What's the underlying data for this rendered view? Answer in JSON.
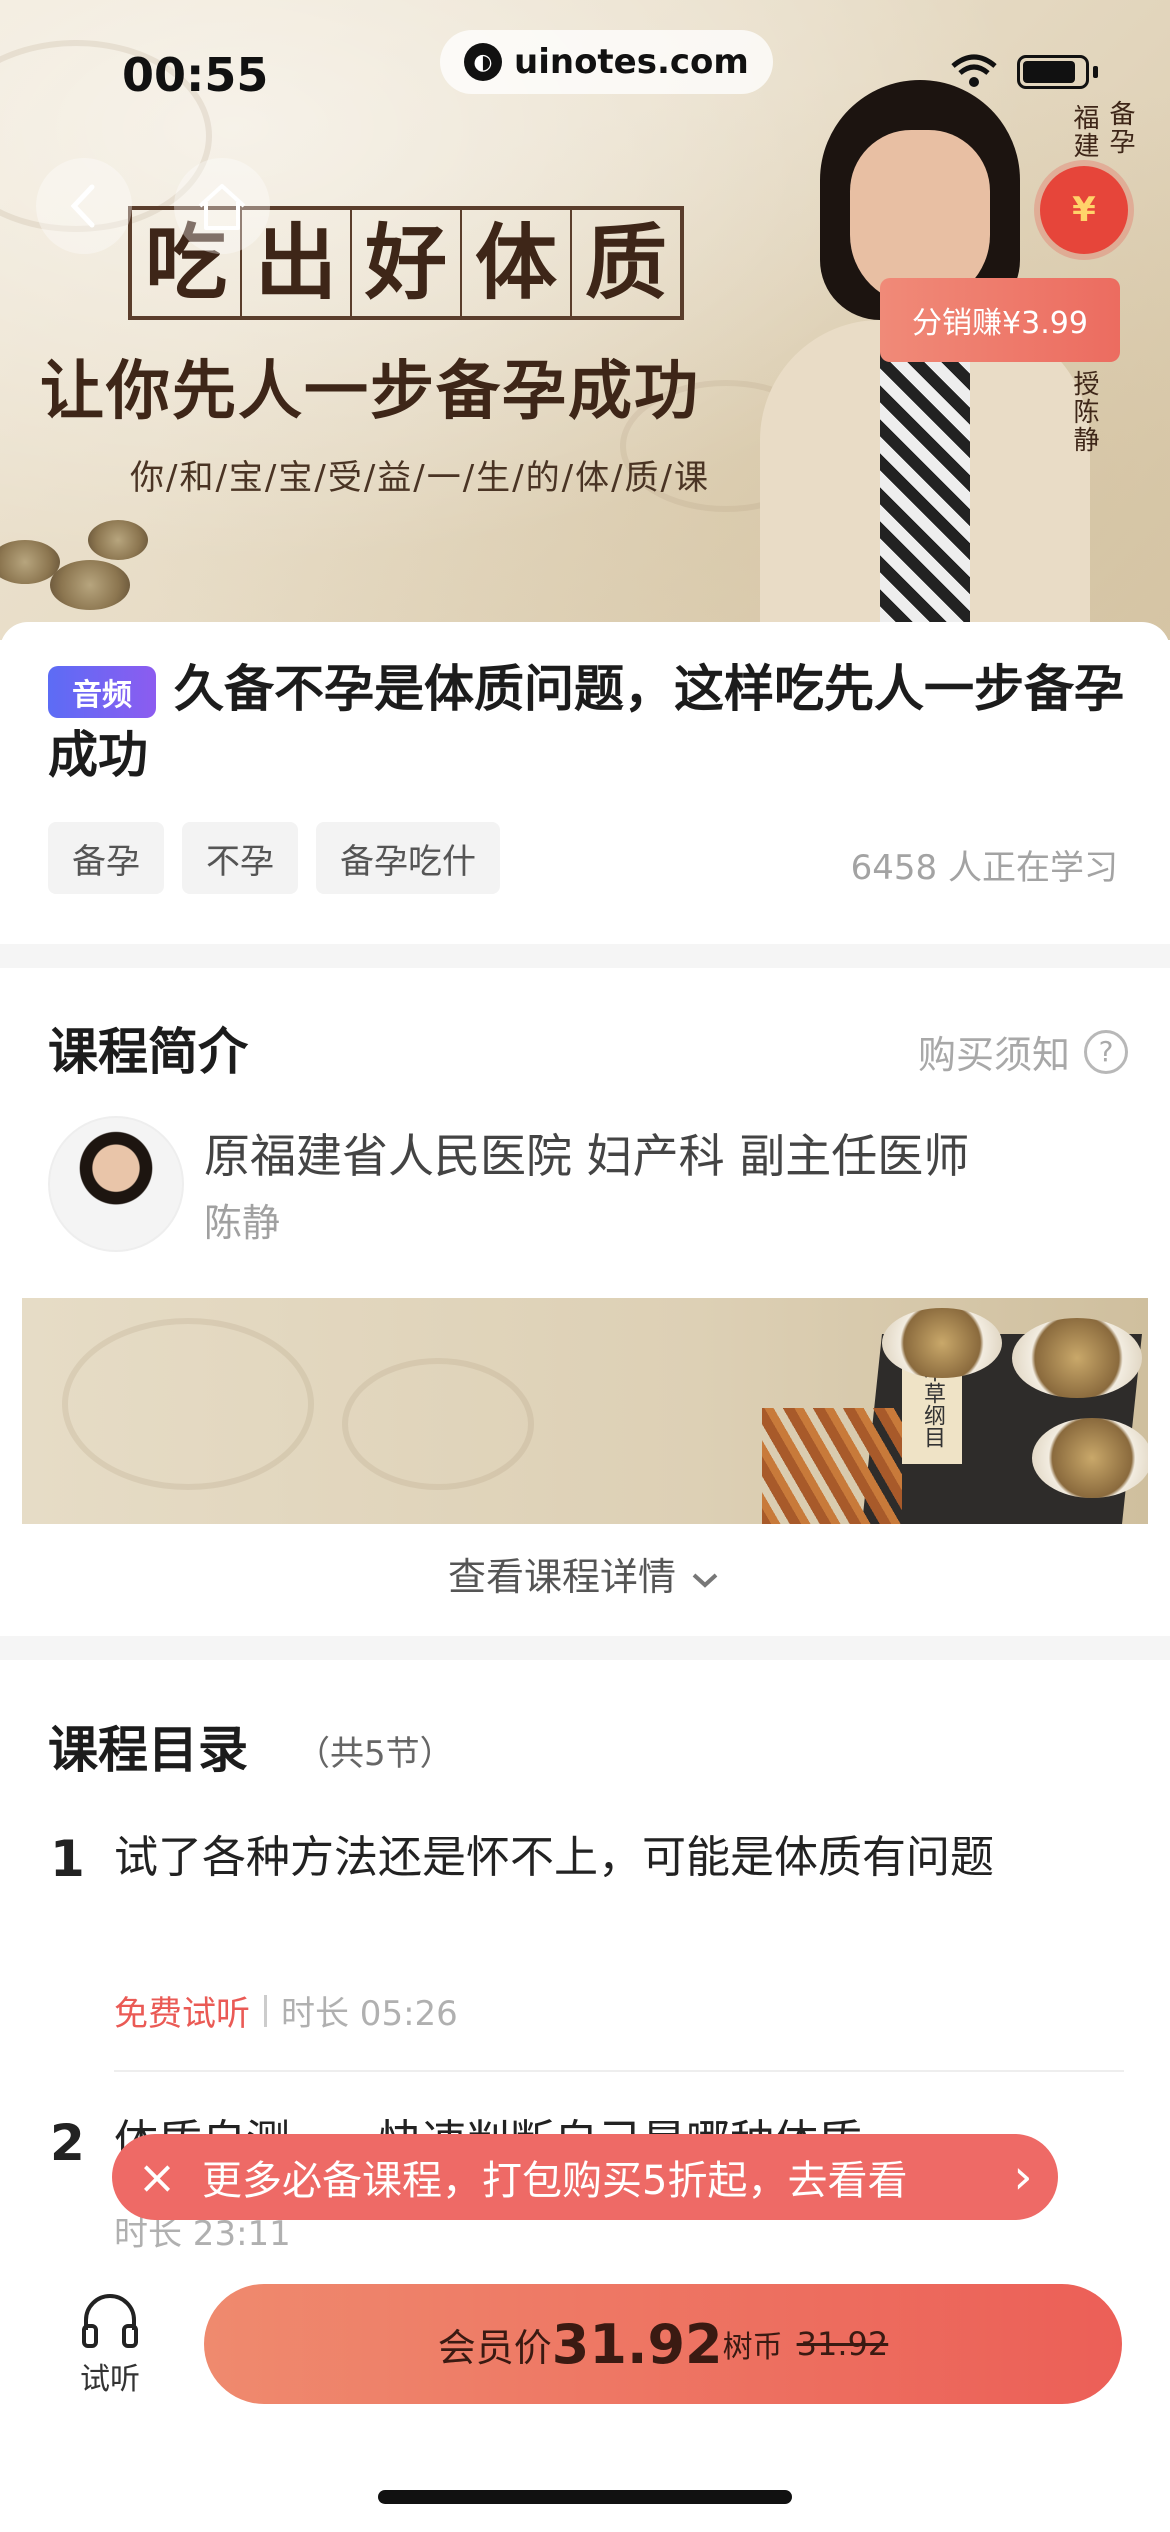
{
  "status_bar": {
    "time": "00:55",
    "url": "uinotes.com"
  },
  "hero": {
    "headline_chars": [
      "吃",
      "出",
      "好",
      "体",
      "质"
    ],
    "subtitle": "让你先人一步备孕成功",
    "tagline": "你/和/宝/宝/受/益/一/生/的/体/质/课",
    "side_text_left": "福建",
    "side_text_right": "备孕",
    "side_text_bottom": "授陈静",
    "coin_symbol": "¥",
    "distribution_badge": "分销赚¥3.99"
  },
  "course": {
    "type_tag": "音频",
    "title": "久备不孕是体质问题，这样吃先人一步备孕成功",
    "tags": [
      "备孕",
      "不孕",
      "备孕吃什"
    ],
    "learners": "6458 人正在学习"
  },
  "intro": {
    "heading": "课程简介",
    "purchase_notice": "购买须知",
    "purchase_notice_icon": "?",
    "doctor_title": "原福建省人民医院 妇产科 副主任医师",
    "doctor_name": "陈静",
    "banner_book_title": "本草纲目",
    "view_details": "查看课程详情"
  },
  "catalog": {
    "heading": "课程目录",
    "count": "（共5节）",
    "lessons": [
      {
        "number": "1",
        "title": "试了各种方法还是怀不上，可能是体质有问题",
        "free_label": "免费试听",
        "duration": "时长 05:26"
      },
      {
        "number": "2",
        "title": "体质自测——快速判断自己是哪种体质",
        "duration": "时长 23:11"
      }
    ]
  },
  "promo": {
    "close": "×",
    "text": "更多必备课程，打包购买5折起，去看看",
    "arrow": "›"
  },
  "bottom_bar": {
    "listen_label": "试听",
    "price_prefix": "会员价",
    "price": "31.92",
    "currency": "树币",
    "original_price": "31.92"
  },
  "colors": {
    "accent_red": "#ec5f57",
    "audio_tag": "#6a64f3",
    "free_red": "#ea5a55"
  },
  "icons": [
    "back-icon",
    "home-icon",
    "wifi-icon",
    "battery-icon",
    "question-icon",
    "chevron-down-icon",
    "close-icon",
    "chevron-right-icon",
    "headphones-icon"
  ]
}
